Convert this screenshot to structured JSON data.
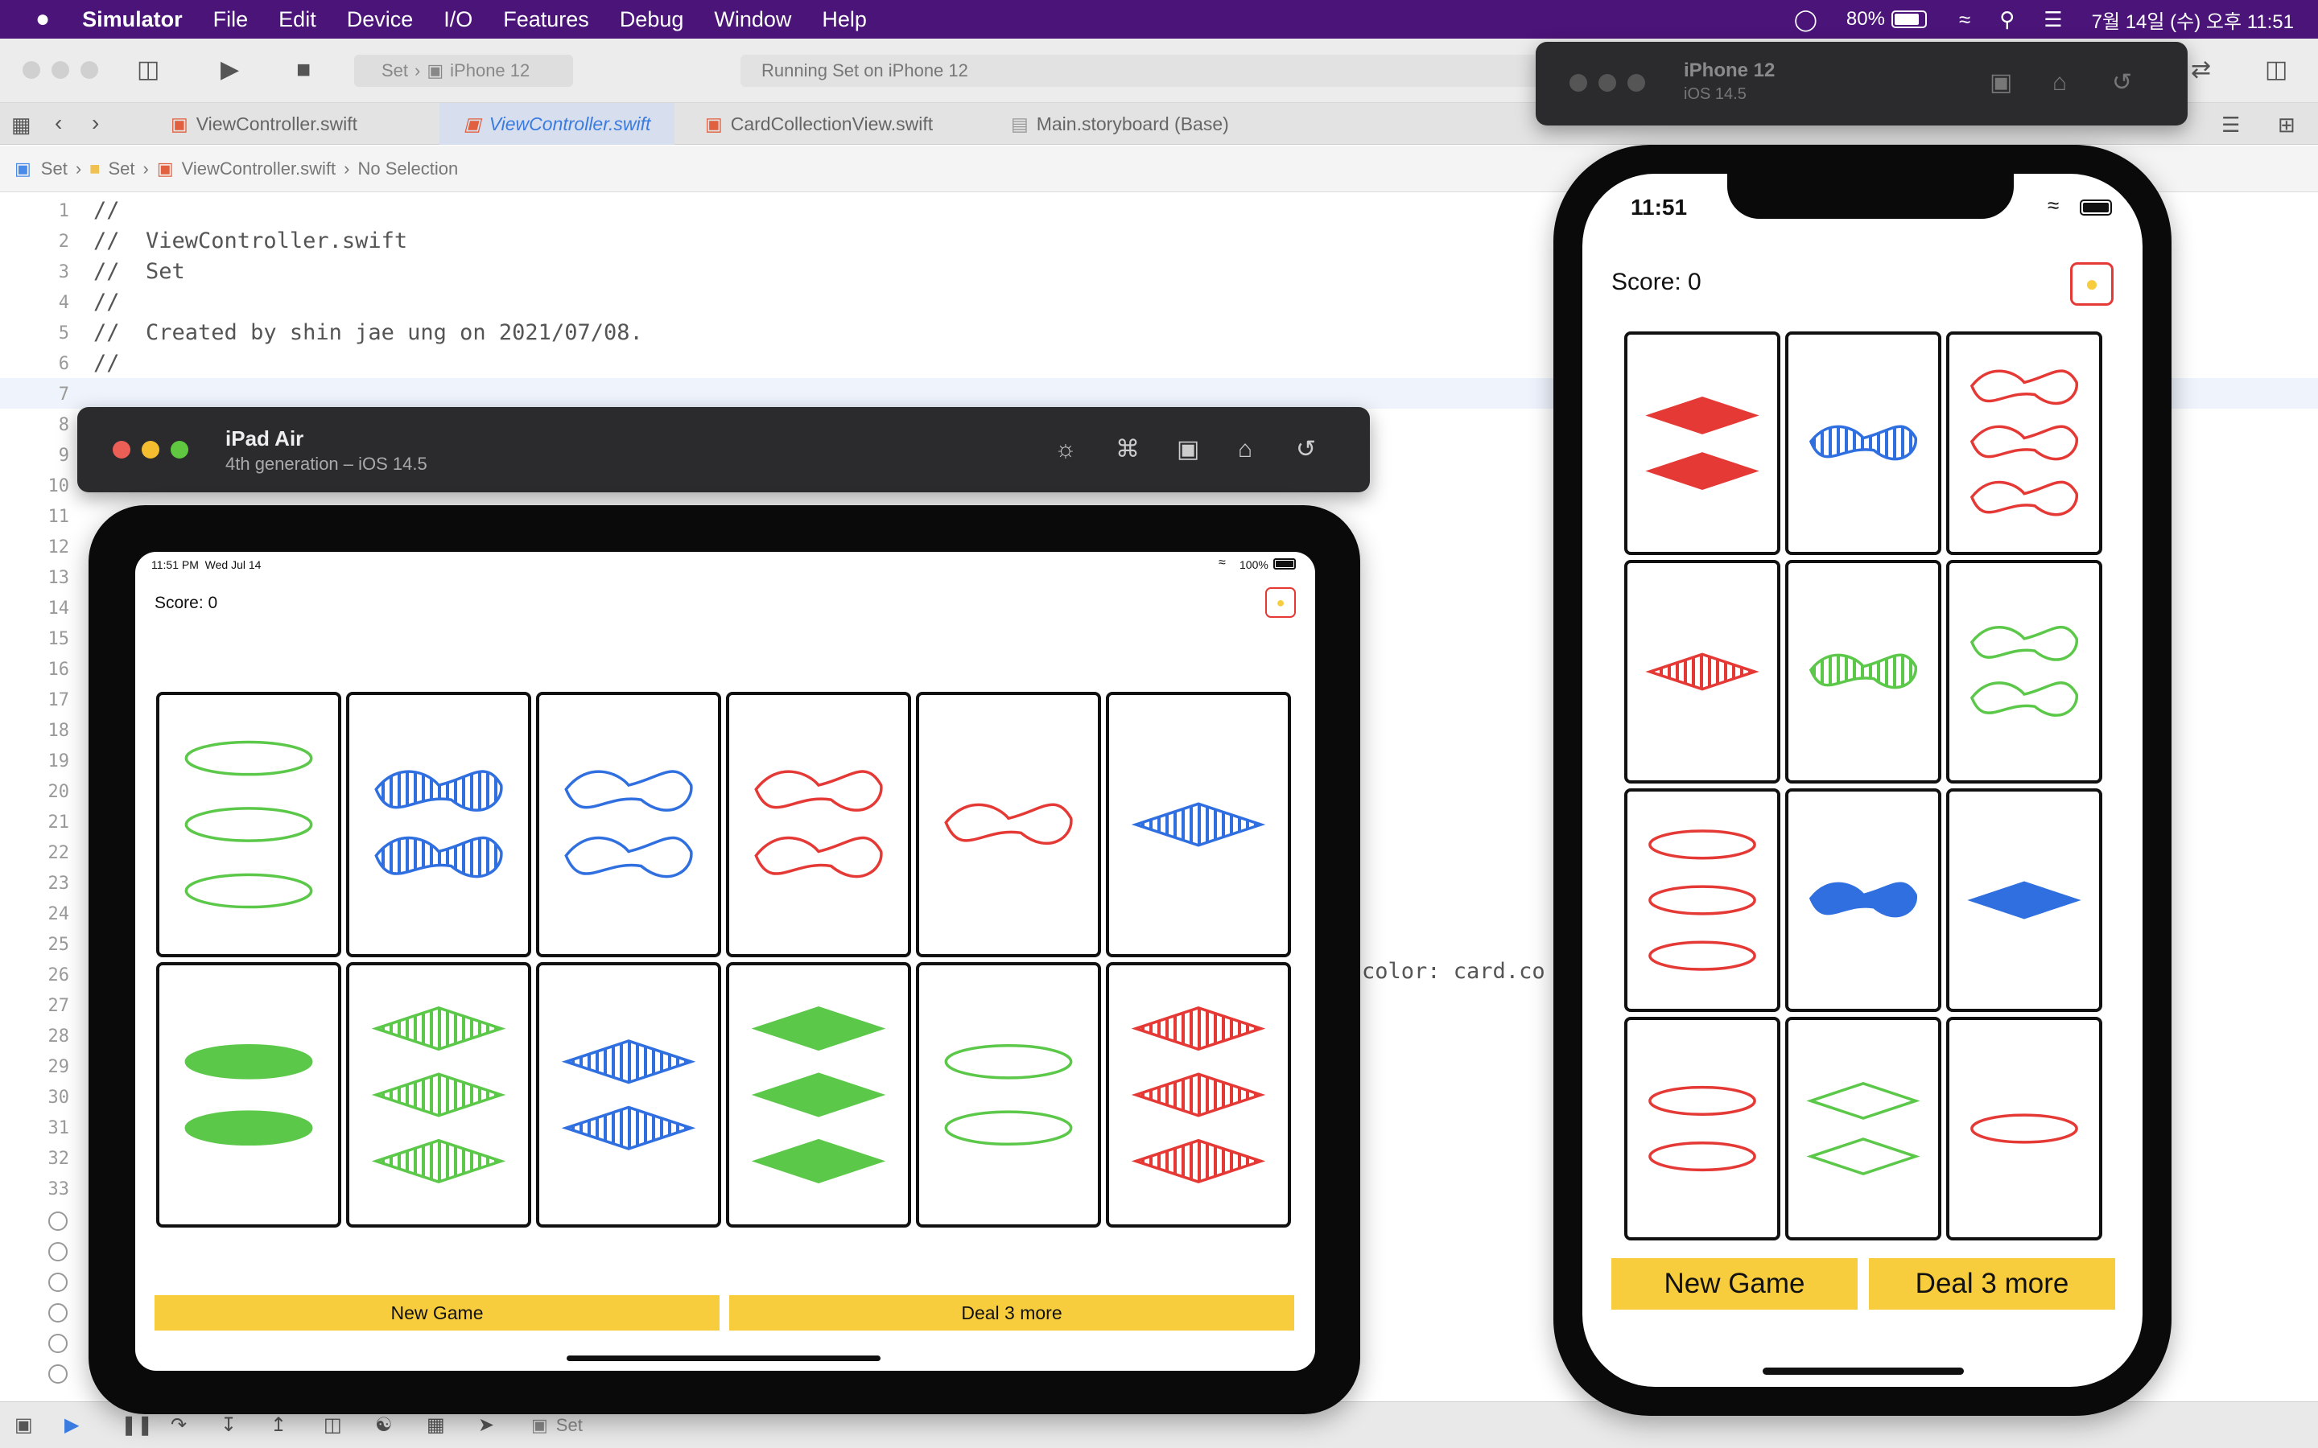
{
  "menubar": {
    "app_name": "Simulator",
    "items": [
      "File",
      "Edit",
      "Device",
      "I/O",
      "Features",
      "Debug",
      "Window",
      "Help"
    ],
    "battery": "80%",
    "datetime": "7월 14일 (수) 오후 11:51"
  },
  "toolbar": {
    "scheme": "Set",
    "destination": "iPhone 12",
    "status": "Running Set on iPhone 12"
  },
  "tabs": [
    "ViewController.swift",
    "ViewController.swift",
    "CardCollectionView.swift",
    "Main.storyboard (Base)"
  ],
  "breadcrumb": [
    "Set",
    "Set",
    "ViewController.swift",
    "No Selection"
  ],
  "code": {
    "line_numbers": [
      "1",
      "2",
      "3",
      "4",
      "5",
      "6",
      "7",
      "8",
      "9",
      "10",
      "11",
      "12",
      "13",
      "14",
      "15",
      "16",
      "17",
      "18",
      "19",
      "20",
      "21",
      "22",
      "23",
      "24",
      "25",
      "26",
      "27",
      "28",
      "29",
      "30",
      "31",
      "32",
      "33"
    ],
    "lines": [
      "//",
      "//  ViewController.swift",
      "//  Set",
      "//",
      "//  Created by shin jae ung on 2021/07/08.",
      "//"
    ],
    "partial_line": "color: card.co"
  },
  "bottom_bar": {
    "scheme": "Set"
  },
  "ipad": {
    "window_title": "iPad Air",
    "window_subtitle": "4th generation – iOS 14.5",
    "status_time": "11:51 PM  Wed Jul 14",
    "status_battery": "100%",
    "score": "Score: 0",
    "hint_icon": "lightbulb-icon",
    "new_game": "New Game",
    "deal_more": "Deal 3 more",
    "cards": [
      {
        "count": 3,
        "shape": "oval",
        "color": "green",
        "fill": "open"
      },
      {
        "count": 2,
        "shape": "squiggle",
        "color": "blue",
        "fill": "striped"
      },
      {
        "count": 2,
        "shape": "squiggle",
        "color": "blue",
        "fill": "open"
      },
      {
        "count": 2,
        "shape": "squiggle",
        "color": "red",
        "fill": "open"
      },
      {
        "count": 1,
        "shape": "squiggle",
        "color": "red",
        "fill": "open"
      },
      {
        "count": 1,
        "shape": "diamond",
        "color": "blue",
        "fill": "striped"
      },
      {
        "count": 2,
        "shape": "oval",
        "color": "green",
        "fill": "solid"
      },
      {
        "count": 3,
        "shape": "diamond",
        "color": "green",
        "fill": "striped"
      },
      {
        "count": 2,
        "shape": "diamond",
        "color": "blue",
        "fill": "striped"
      },
      {
        "count": 3,
        "shape": "diamond",
        "color": "green",
        "fill": "solid"
      },
      {
        "count": 2,
        "shape": "oval",
        "color": "green",
        "fill": "open"
      },
      {
        "count": 3,
        "shape": "diamond",
        "color": "red",
        "fill": "striped"
      }
    ]
  },
  "iphone": {
    "window_title": "iPhone 12",
    "window_subtitle": "iOS 14.5",
    "status_time": "11:51",
    "score": "Score: 0",
    "hint_icon": "lightbulb-icon",
    "new_game": "New Game",
    "deal_more": "Deal 3 more",
    "cards": [
      {
        "count": 2,
        "shape": "diamond",
        "color": "red",
        "fill": "solid"
      },
      {
        "count": 1,
        "shape": "squiggle",
        "color": "blue",
        "fill": "striped"
      },
      {
        "count": 3,
        "shape": "squiggle",
        "color": "red",
        "fill": "open"
      },
      {
        "count": 1,
        "shape": "diamond",
        "color": "red",
        "fill": "striped"
      },
      {
        "count": 1,
        "shape": "squiggle",
        "color": "green",
        "fill": "striped"
      },
      {
        "count": 2,
        "shape": "squiggle",
        "color": "green",
        "fill": "open"
      },
      {
        "count": 3,
        "shape": "oval",
        "color": "red",
        "fill": "open"
      },
      {
        "count": 1,
        "shape": "squiggle",
        "color": "blue",
        "fill": "solid"
      },
      {
        "count": 1,
        "shape": "diamond",
        "color": "blue",
        "fill": "solid"
      },
      {
        "count": 2,
        "shape": "oval",
        "color": "red",
        "fill": "open"
      },
      {
        "count": 2,
        "shape": "diamond",
        "color": "green",
        "fill": "open"
      },
      {
        "count": 1,
        "shape": "oval",
        "color": "red",
        "fill": "open"
      }
    ]
  },
  "colors": {
    "red": "#e53935",
    "green": "#5cc84a",
    "blue": "#2f6fe0",
    "button": "#f8cd3d",
    "menubar": "#4a1478"
  }
}
